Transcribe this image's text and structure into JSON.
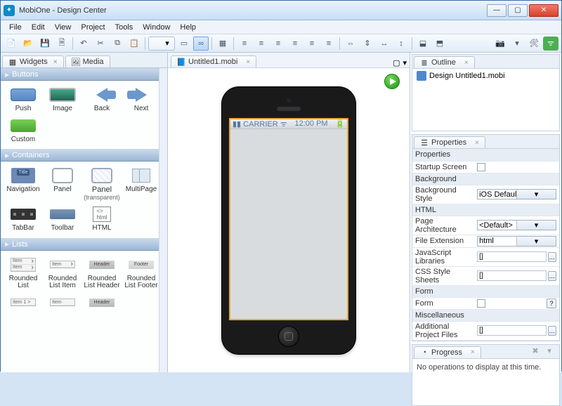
{
  "window": {
    "title": "MobiOne - Design Center"
  },
  "menu": [
    "File",
    "Edit",
    "View",
    "Project",
    "Tools",
    "Window",
    "Help"
  ],
  "tabs_left": [
    {
      "icon": "widgets-icon",
      "label": "Widgets",
      "closable": true
    },
    {
      "icon": "media-icon",
      "label": "Media",
      "closable": false
    }
  ],
  "doc_tabs": [
    {
      "icon": "design-doc-icon",
      "label": "Untitled1.mobi"
    }
  ],
  "widgets": {
    "sections": {
      "buttons": {
        "title": "Buttons",
        "items": [
          {
            "name": "push",
            "label": "Push"
          },
          {
            "name": "image",
            "label": "Image"
          },
          {
            "name": "back",
            "label": "Back"
          },
          {
            "name": "next",
            "label": "Next"
          },
          {
            "name": "custom",
            "label": "Custom"
          }
        ]
      },
      "containers": {
        "title": "Containers",
        "items": [
          {
            "name": "navigation",
            "label": "Navigation"
          },
          {
            "name": "panel",
            "label": "Panel"
          },
          {
            "name": "panel-transparent",
            "label": "Panel",
            "sublabel": "(transparent)"
          },
          {
            "name": "multipage",
            "label": "MultiPage"
          },
          {
            "name": "tabbar",
            "label": "TabBar"
          },
          {
            "name": "toolbar",
            "label": "Toolbar"
          },
          {
            "name": "html",
            "label": "HTML"
          }
        ]
      },
      "lists": {
        "title": "Lists",
        "items": [
          {
            "name": "rounded-list",
            "label": "Rounded List"
          },
          {
            "name": "rounded-list-item",
            "label": "Rounded List Item"
          },
          {
            "name": "rounded-list-header",
            "label": "Rounded List Header"
          },
          {
            "name": "rounded-list-footer",
            "label": "Rounded List Footer"
          }
        ],
        "row2_visible": [
          "Item 1 >",
          "Item",
          "Header"
        ]
      }
    }
  },
  "device": {
    "carrier": "CARRIER",
    "time": "12:00 PM"
  },
  "outline": {
    "title": "Outline",
    "root": "Design Untitled1.mobi"
  },
  "properties": {
    "title": "Properties",
    "groups": {
      "properties": {
        "label": "Properties",
        "rows": [
          {
            "key": "startup_screen",
            "label": "Startup Screen",
            "type": "check",
            "value": false
          }
        ]
      },
      "background": {
        "label": "Background",
        "rows": [
          {
            "key": "background_style",
            "label": "Background Style",
            "type": "dropdown",
            "value": "iOS Default (strip..."
          }
        ]
      },
      "html": {
        "label": "HTML",
        "rows": [
          {
            "key": "page_architecture",
            "label": "Page Architecture",
            "type": "dropdown",
            "value": "<Default>"
          },
          {
            "key": "file_extension",
            "label": "File Extension",
            "type": "dropdown",
            "value": "html"
          },
          {
            "key": "js_libraries",
            "label": "JavaScript Libraries",
            "type": "list",
            "value": "[]"
          },
          {
            "key": "css_stylesheets",
            "label": "CSS Style Sheets",
            "type": "list",
            "value": "[]"
          }
        ]
      },
      "form": {
        "label": "Form",
        "rows": [
          {
            "key": "form",
            "label": "Form",
            "type": "checkhelp",
            "value": false
          }
        ]
      },
      "misc": {
        "label": "Miscellaneous",
        "rows": [
          {
            "key": "additional_project_files",
            "label": "Additional Project Files",
            "type": "list",
            "value": "[]"
          }
        ]
      }
    }
  },
  "progress": {
    "title": "Progress",
    "message": "No operations to display at this time."
  }
}
